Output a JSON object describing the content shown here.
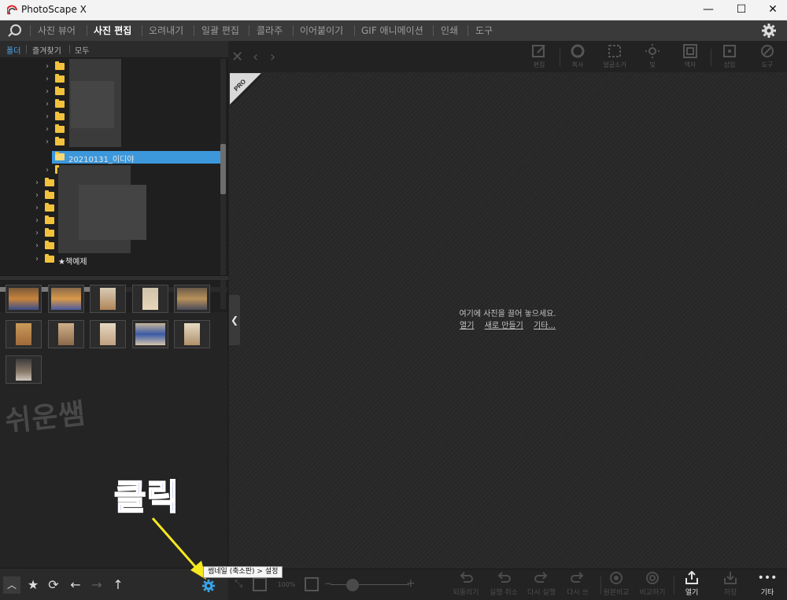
{
  "window": {
    "title": "PhotoScape X",
    "controls": [
      "minimize",
      "maximize",
      "close"
    ]
  },
  "menu": {
    "items": [
      {
        "label": "사진 뷰어",
        "active": false
      },
      {
        "label": "사진 편집",
        "active": true
      },
      {
        "label": "오려내기",
        "active": false
      },
      {
        "label": "일괄 편집",
        "active": false
      },
      {
        "label": "콜라주",
        "active": false
      },
      {
        "label": "이어붙이기",
        "active": false
      },
      {
        "label": "GIF 애니메이션",
        "active": false
      },
      {
        "label": "인쇄",
        "active": false
      },
      {
        "label": "도구",
        "active": false
      }
    ]
  },
  "left_panel": {
    "tabs": [
      "폴더",
      "즐겨찾기",
      "모두"
    ],
    "active_tab": "폴더",
    "tree": {
      "selected_folder": "20210131_이디야",
      "named_folder": "★책예제"
    }
  },
  "left_toolbar": {
    "buttons": [
      "chevron-up-icon",
      "star-icon",
      "refresh-icon",
      "back-arrow-icon",
      "forward-arrow-icon",
      "up-arrow-icon",
      "gear-icon"
    ]
  },
  "stage": {
    "badge": "PRO",
    "drop_message": "여기에 사진을 끌어 놓으세요.",
    "links": [
      "열기",
      "새로 만들기",
      "기타..."
    ],
    "tools": [
      "편집",
      "복사",
      "얼굴소거",
      "빛",
      "액자",
      "삽입",
      "도구"
    ]
  },
  "bottom_toolbar": {
    "zoom_value": "100%",
    "buttons": [
      {
        "label": "되돌리기",
        "enabled": false
      },
      {
        "label": "실행 취소",
        "enabled": false
      },
      {
        "label": "다시 실행",
        "enabled": false
      },
      {
        "label": "다시 쓰",
        "enabled": false
      },
      {
        "label": "원본비교",
        "enabled": false
      },
      {
        "label": "비교하기",
        "enabled": false
      },
      {
        "label": "열기",
        "enabled": true
      },
      {
        "label": "저장",
        "enabled": false
      },
      {
        "label": "기타",
        "enabled": true
      }
    ]
  },
  "tooltip": "썸네일 (축소판) > 설정",
  "annotation": {
    "callout": "클릭",
    "watermark": "쉬운쌤"
  },
  "colors": {
    "accent": "#3c98db",
    "folder": "#f3c23c",
    "callout": "#1e3fd6",
    "arrow": "#f5e91e"
  }
}
